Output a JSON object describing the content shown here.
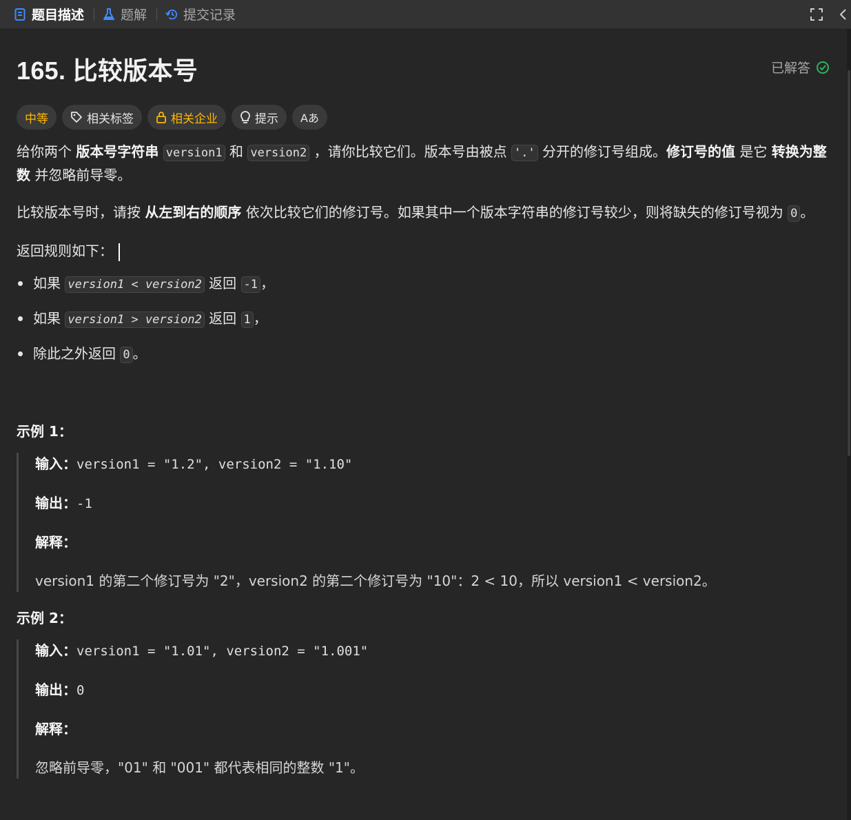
{
  "tabs": [
    {
      "label": "题目描述",
      "icon": "description-icon",
      "active": true
    },
    {
      "label": "题解",
      "icon": "flask-icon",
      "active": false
    },
    {
      "label": "提交记录",
      "icon": "history-icon",
      "active": false
    }
  ],
  "problem": {
    "title": "165. 比较版本号",
    "status": "已解答",
    "tags": {
      "difficulty": "中等",
      "related_tags": "相关标签",
      "related_companies": "相关企业",
      "hint": "提示",
      "font_icon_label": "Aあ"
    },
    "para1": {
      "t1": "给你两个 ",
      "b1": "版本号字符串",
      "c1": "version1",
      "t2": " 和 ",
      "c2": "version2",
      "t3": " ，请你比较它们。版本号由被点 ",
      "c3": "'.'",
      "t4": " 分开的修订号组成。",
      "b2": "修订号的值",
      "t5": " 是它 ",
      "b3": "转换为整数",
      "t6": " 并忽略前导零。"
    },
    "para2": {
      "t1": "比较版本号时，请按 ",
      "b1": "从左到右的顺序",
      "t2": " 依次比较它们的修订号。如果其中一个版本字符串的修订号较少，则将缺失的修订号视为 ",
      "c1": "0",
      "t3": "。"
    },
    "para3": "返回规则如下：",
    "rules": [
      {
        "pre": "如果 ",
        "cond": "version1 < version2",
        "mid": " 返回 ",
        "val": "-1",
        "post": "，"
      },
      {
        "pre": "如果 ",
        "cond": "version1 > version2",
        "mid": " 返回 ",
        "val": "1",
        "post": "，"
      },
      {
        "pre": "除此之外返回 ",
        "val": "0",
        "post": "。"
      }
    ],
    "examples": [
      {
        "title": "示例 1：",
        "input_label": "输入：",
        "input": "version1 = \"1.2\", version2 = \"1.10\"",
        "output_label": "输出：",
        "output": "-1",
        "explain_label": "解释：",
        "explain": "version1 的第二个修订号为 \"2\"，version2 的第二个修订号为 \"10\"：2 < 10，所以 version1 < version2。"
      },
      {
        "title": "示例 2：",
        "input_label": "输入：",
        "input": "version1 = \"1.01\", version2 = \"1.001\"",
        "output_label": "输出：",
        "output": "0",
        "explain_label": "解释：",
        "explain": "忽略前导零，\"01\" 和 \"001\" 都代表相同的整数 \"1\"。"
      }
    ]
  },
  "colors": {
    "background": "#262626",
    "topbar": "#333333",
    "difficulty_medium": "#ffb800",
    "solved_check": "#2db55d",
    "active_tab_icon": "#3e8bff"
  }
}
